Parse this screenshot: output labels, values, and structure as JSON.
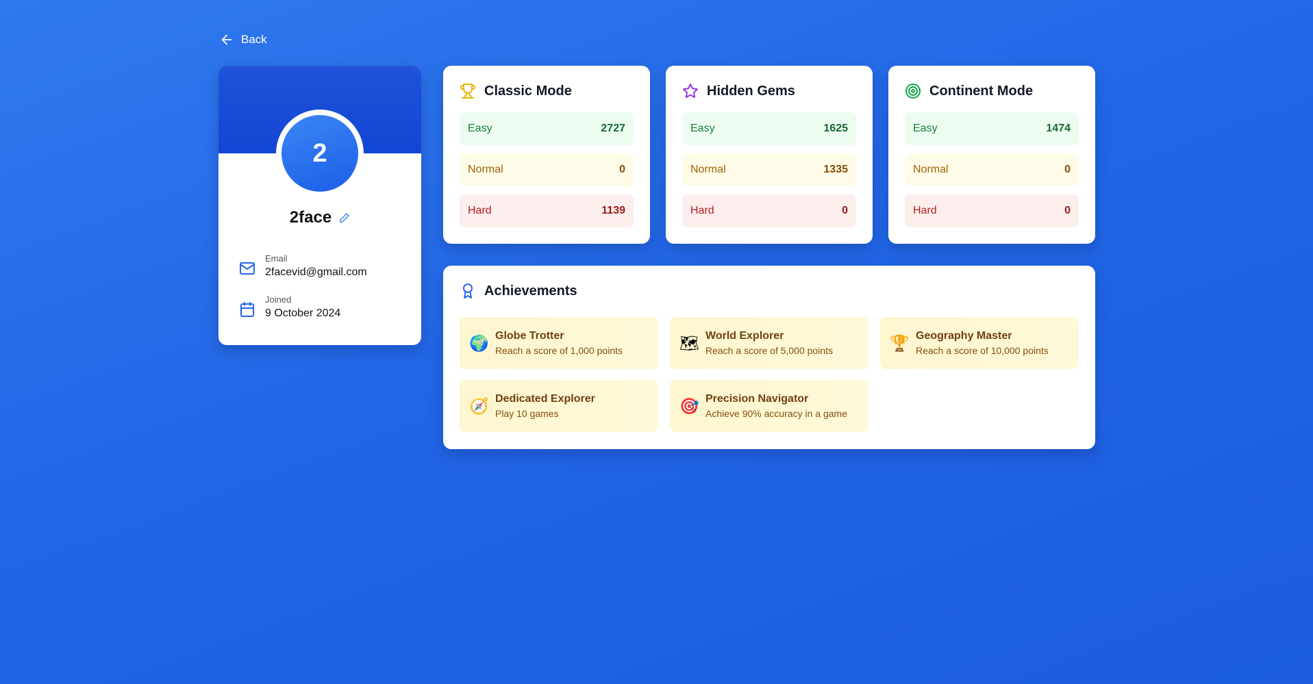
{
  "nav": {
    "back_label": "Back"
  },
  "profile": {
    "avatar_initial": "2",
    "username": "2face",
    "email_label": "Email",
    "email": "2facevid@gmail.com",
    "joined_label": "Joined",
    "joined": "9 October 2024"
  },
  "modes": [
    {
      "title": "Classic Mode",
      "icon": "trophy-icon",
      "easy_label": "Easy",
      "easy": "2727",
      "normal_label": "Normal",
      "normal": "0",
      "hard_label": "Hard",
      "hard": "1139"
    },
    {
      "title": "Hidden Gems",
      "icon": "star-icon",
      "easy_label": "Easy",
      "easy": "1625",
      "normal_label": "Normal",
      "normal": "1335",
      "hard_label": "Hard",
      "hard": "0"
    },
    {
      "title": "Continent Mode",
      "icon": "target-icon",
      "easy_label": "Easy",
      "easy": "1474",
      "normal_label": "Normal",
      "normal": "0",
      "hard_label": "Hard",
      "hard": "0"
    }
  ],
  "achievements": {
    "title": "Achievements",
    "items": [
      {
        "emoji": "🌍",
        "icon": "globe-icon",
        "title": "Globe Trotter",
        "desc": "Reach a score of 1,000 points"
      },
      {
        "emoji": "🗺",
        "icon": "map-icon",
        "title": "World Explorer",
        "desc": "Reach a score of 5,000 points"
      },
      {
        "emoji": "🏆",
        "icon": "trophy-icon",
        "title": "Geography Master",
        "desc": "Reach a score of 10,000 points"
      },
      {
        "emoji": "🧭",
        "icon": "compass-icon",
        "title": "Dedicated Explorer",
        "desc": "Play 10 games"
      },
      {
        "emoji": "🎯",
        "icon": "bullseye-icon",
        "title": "Precision Navigator",
        "desc": "Achieve 90% accuracy in a game"
      }
    ]
  },
  "colors": {
    "background": "#2266e6",
    "banner": "#1245d4",
    "accent": "#2563eb"
  }
}
